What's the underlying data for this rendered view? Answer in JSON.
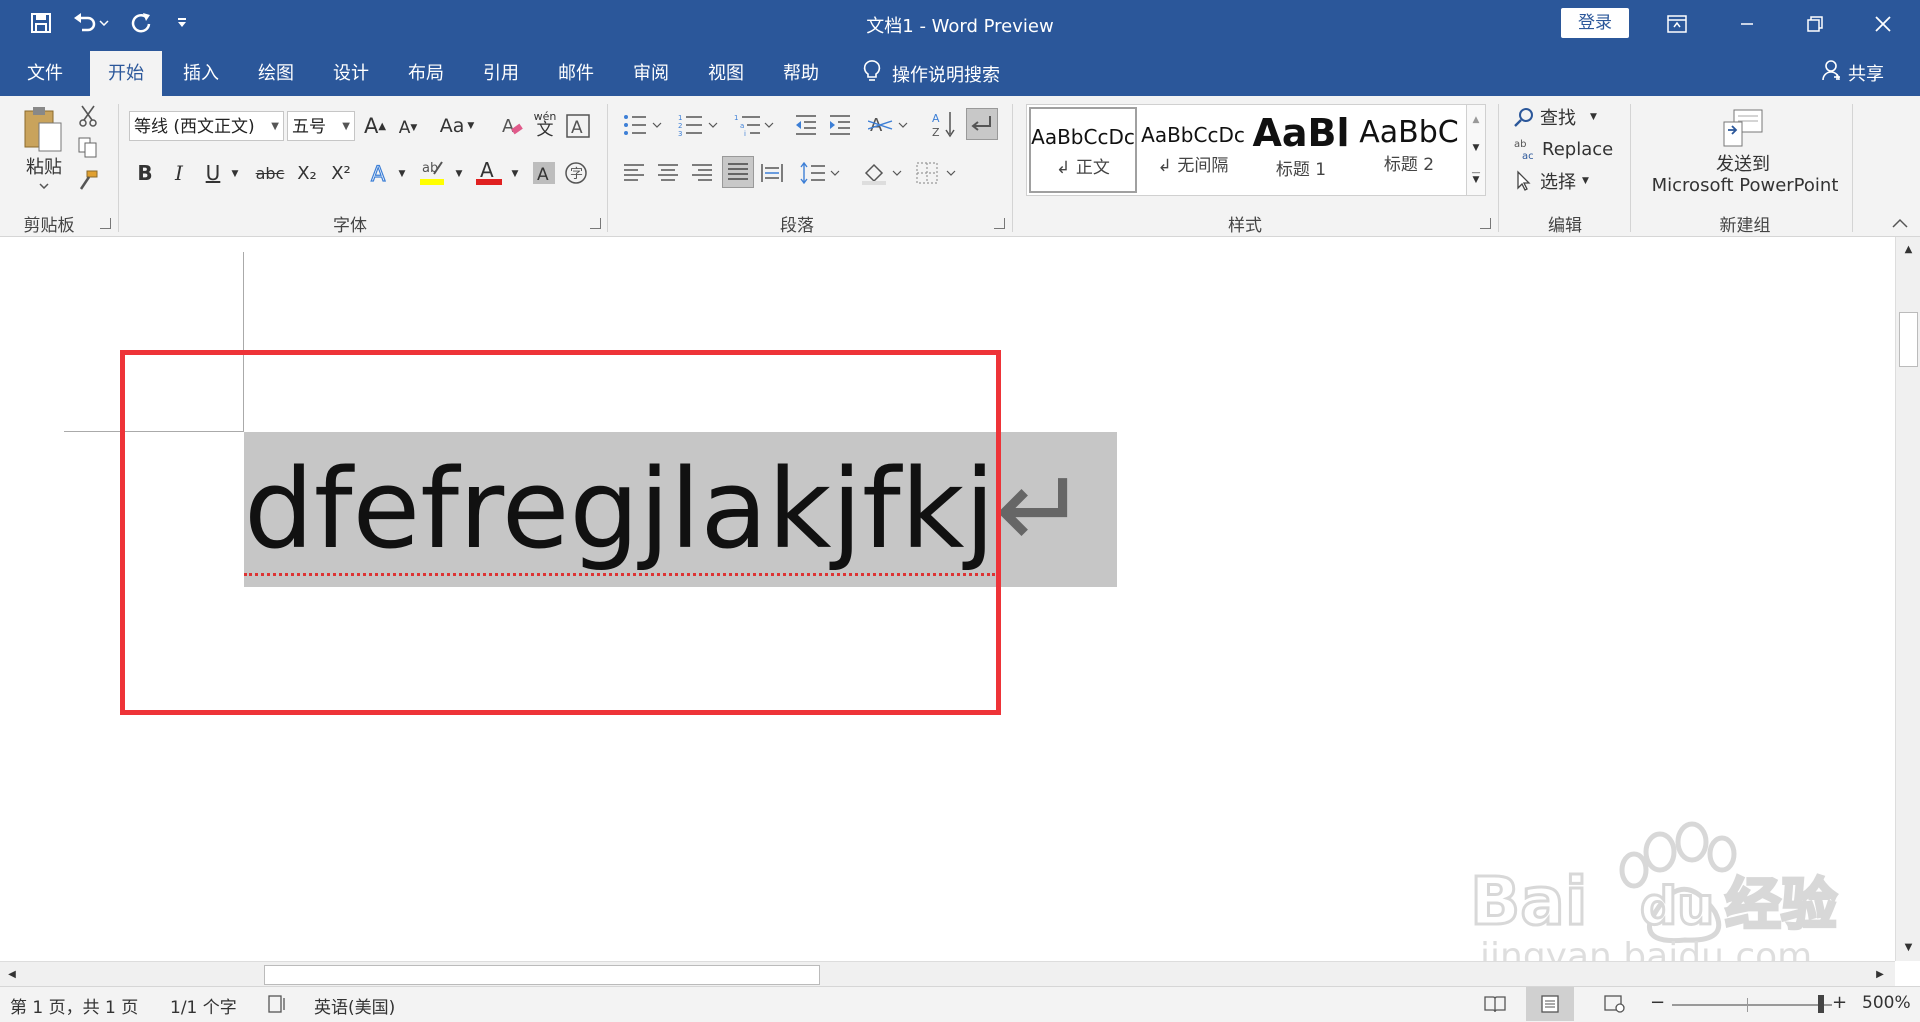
{
  "titlebar": {
    "title": "文档1  -  Word Preview",
    "login_label": "登录",
    "window_buttons": [
      "ribbon-display-icon",
      "minimize-icon",
      "restore-icon",
      "close-icon"
    ]
  },
  "menu": {
    "tabs": [
      "文件",
      "开始",
      "插入",
      "绘图",
      "设计",
      "布局",
      "引用",
      "邮件",
      "审阅",
      "视图",
      "帮助"
    ],
    "active_tab": "开始",
    "tell_me": "操作说明搜索",
    "share": "共享"
  },
  "ribbon": {
    "clipboard": {
      "paste_label": "粘贴",
      "group_label": "剪贴板"
    },
    "font": {
      "font_name": "等线 (西文正文)",
      "font_size": "五号",
      "group_label": "字体",
      "bold": "B",
      "italic": "I",
      "underline": "U",
      "strike": "abc",
      "subscript": "X₂",
      "superscript": "X²",
      "change_case": "Aa",
      "grow": "A",
      "shrink": "A",
      "phonetic_top": "wén",
      "phonetic_bottom": "文"
    },
    "paragraph": {
      "group_label": "段落"
    },
    "styles": {
      "group_label": "样式",
      "items": [
        {
          "sample": "AaBbCcDc",
          "name": "↲ 正文"
        },
        {
          "sample": "AaBbCcDc",
          "name": "↲ 无间隔"
        },
        {
          "sample": "AaBl",
          "name": "标题 1"
        },
        {
          "sample": "AaBbC",
          "name": "标题 2"
        }
      ]
    },
    "editing": {
      "find": "查找",
      "replace": "Replace",
      "select": "选择",
      "group_label": "编辑"
    },
    "new_group": {
      "send_line1": "发送到",
      "send_line2": "Microsoft PowerPoint",
      "group_label": "新建组"
    }
  },
  "document": {
    "text": "dfefregjlakjfkj",
    "paragraph_mark": "↵"
  },
  "watermark": {
    "brand": "Bai",
    "brand2": "du",
    "cn": "经验",
    "url": "jingyan.baidu.com"
  },
  "statusbar": {
    "page": "第 1 页，共 1 页",
    "words": "1/1 个字",
    "language": "英语(美国)",
    "zoom": "500%"
  },
  "colors": {
    "brand": "#2b579a",
    "highlight_box": "#ee3338",
    "selection": "#c6c6c6"
  }
}
